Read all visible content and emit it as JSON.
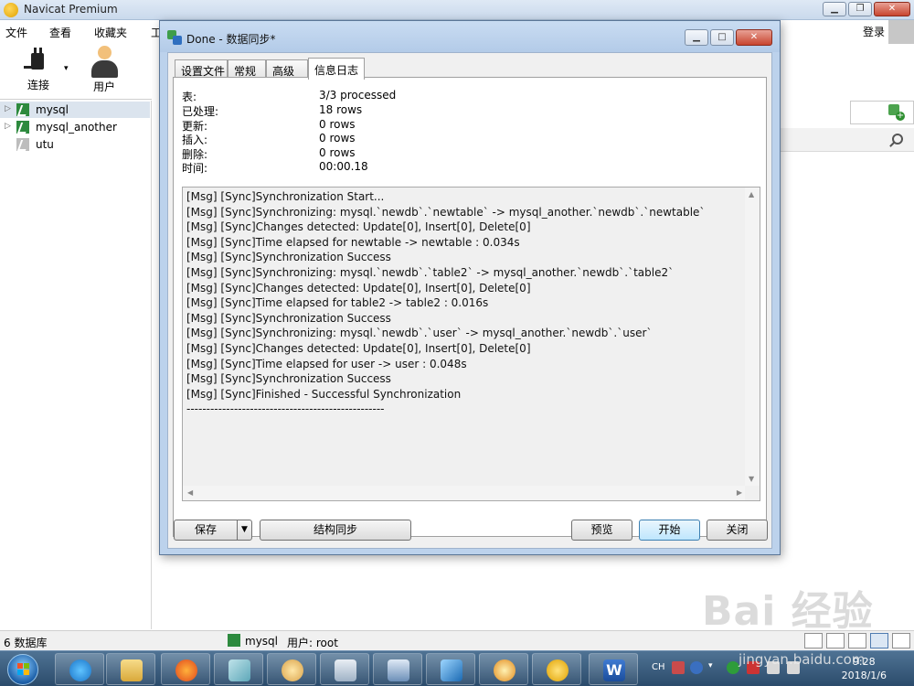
{
  "app": {
    "title": "Navicat Premium",
    "menu": [
      "文件",
      "查看",
      "收藏夹",
      "工"
    ],
    "login": "登录",
    "toolbar": {
      "connect": "连接",
      "user": "用户"
    },
    "connections": [
      {
        "name": "mysql",
        "selected": true,
        "expandable": true,
        "status": "open"
      },
      {
        "name": "mysql_another",
        "selected": false,
        "expandable": true,
        "status": "open"
      },
      {
        "name": "utu",
        "selected": false,
        "expandable": false,
        "status": "closed"
      }
    ],
    "status": {
      "db_count": "6 数据库",
      "connection": "mysql",
      "user": "用户: root"
    }
  },
  "dialog": {
    "title": "Done - 数据同步*",
    "tabs": [
      "设置文件",
      "常规",
      "高级",
      "信息日志"
    ],
    "active_tab": "信息日志",
    "summary": [
      {
        "label": "表:",
        "value": "3/3 processed"
      },
      {
        "label": "已处理:",
        "value": "18 rows"
      },
      {
        "label": "更新:",
        "value": "0 rows"
      },
      {
        "label": "插入:",
        "value": "0 rows"
      },
      {
        "label": "删除:",
        "value": "0 rows"
      },
      {
        "label": "时间:",
        "value": "00:00.18"
      }
    ],
    "log": [
      "[Msg] [Sync]Synchronization Start...",
      "[Msg] [Sync]Synchronizing: mysql.`newdb`.`newtable` -> mysql_another.`newdb`.`newtable`",
      "[Msg] [Sync]Changes detected: Update[0], Insert[0], Delete[0]",
      "[Msg] [Sync]Time elapsed for newtable -> newtable : 0.034s",
      "[Msg] [Sync]Synchronization Success",
      "[Msg] [Sync]Synchronizing: mysql.`newdb`.`table2` -> mysql_another.`newdb`.`table2`",
      "[Msg] [Sync]Changes detected: Update[0], Insert[0], Delete[0]",
      "[Msg] [Sync]Time elapsed for table2 -> table2 : 0.016s",
      "[Msg] [Sync]Synchronization Success",
      "[Msg] [Sync]Synchronizing: mysql.`newdb`.`user` -> mysql_another.`newdb`.`user`",
      "[Msg] [Sync]Changes detected: Update[0], Insert[0], Delete[0]",
      "[Msg] [Sync]Time elapsed for user -> user : 0.048s",
      "[Msg] [Sync]Synchronization Success",
      "[Msg] [Sync]Finished - Successful Synchronization",
      "--------------------------------------------------"
    ],
    "buttons": {
      "save": "保存",
      "structure_sync": "结构同步",
      "preview": "预览",
      "start": "开始",
      "close": "关闭"
    }
  },
  "taskbar": {
    "lang": "CH",
    "time": "9:28",
    "date": "2018/1/6",
    "apps": [
      "internet-explorer",
      "file-explorer",
      "firefox",
      "notebook",
      "paint",
      "calculator",
      "remote-desktop",
      "feather-app",
      "search-tool",
      "navicat",
      "word"
    ]
  },
  "watermark": {
    "logo": "Bai 经验",
    "url": "jingyan.baidu.com"
  }
}
